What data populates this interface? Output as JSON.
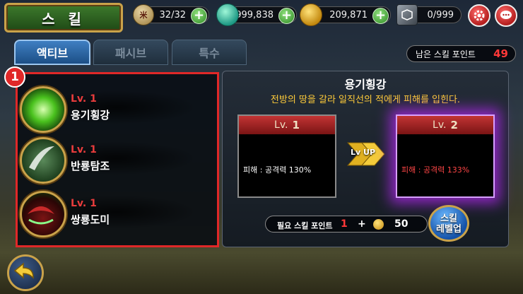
{
  "header": {
    "title": "스 킬"
  },
  "resources": {
    "stamina": {
      "value": "32/32",
      "icon": "money-bag-icon"
    },
    "gems": {
      "value": "999,838",
      "icon": "jade-orb-icon"
    },
    "gold": {
      "value": "209,871",
      "icon": "gold-coin-icon"
    },
    "items": {
      "value": "0/999",
      "icon": "item-box-icon"
    }
  },
  "tabs": [
    {
      "label": "액티브",
      "active": true
    },
    {
      "label": "패시브",
      "active": false
    },
    {
      "label": "특수",
      "active": false
    }
  ],
  "skill_points": {
    "label": "남은 스킬 포인트",
    "value": "49"
  },
  "annotation_badge": "1",
  "skills": [
    {
      "level": "Lv. 1",
      "name": "용기횡강",
      "icon": "green-energy-skill-icon"
    },
    {
      "level": "Lv. 1",
      "name": "반룡탐조",
      "icon": "blade-slash-skill-icon"
    },
    {
      "level": "Lv. 1",
      "name": "쌍룡도미",
      "icon": "dragon-strike-skill-icon"
    }
  ],
  "detail": {
    "name": "용기횡강",
    "description": "전방의 땅을 갈라 일직선의 적에게 피해를 입힌다.",
    "current": {
      "lv_label": "Lv.",
      "lv": "1",
      "effect": "피해 : 공격력 130%"
    },
    "next": {
      "lv_label": "Lv.",
      "lv": "2",
      "effect": "피해 : 공격력 133%"
    },
    "lvup_label": "Lv UP",
    "requirement": {
      "label": "필요 스킬 포인트",
      "points": "1",
      "plus": "+",
      "gold": "50"
    },
    "levelup_button": {
      "line1": "스킬",
      "line2": "레벨업"
    }
  },
  "colors": {
    "accent_red": "#e02828",
    "level_red": "#e83c3c",
    "gold_text": "#ffcc3a",
    "next_glow": "#be28ff"
  }
}
